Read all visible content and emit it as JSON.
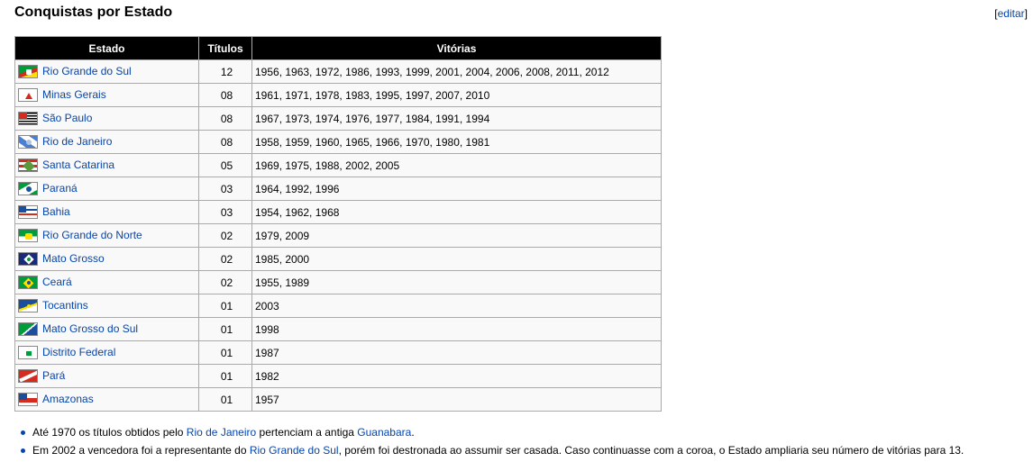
{
  "section": {
    "title": "Conquistas por Estado",
    "edit_open": "[",
    "edit_label": "editar",
    "edit_close": "]"
  },
  "table": {
    "headers": {
      "state": "Estado",
      "titles": "Títulos",
      "wins": "Vitórias"
    },
    "rows": [
      {
        "state": "Rio Grande do Sul",
        "titles": "12",
        "wins": "1956, 1963, 1972, 1986, 1993, 1999, 2001, 2004, 2006, 2008, 2011, 2012",
        "flag_icon": "rio-grande-do-sul-flag-icon"
      },
      {
        "state": "Minas Gerais",
        "titles": "08",
        "wins": "1961, 1971, 1978, 1983, 1995, 1997, 2007, 2010",
        "flag_icon": "minas-gerais-flag-icon"
      },
      {
        "state": "São Paulo",
        "titles": "08",
        "wins": "1967, 1973, 1974, 1976, 1977, 1984, 1991, 1994",
        "flag_icon": "sao-paulo-flag-icon"
      },
      {
        "state": "Rio de Janeiro",
        "titles": "08",
        "wins": "1958, 1959, 1960, 1965, 1966, 1970, 1980, 1981",
        "flag_icon": "rio-de-janeiro-flag-icon"
      },
      {
        "state": "Santa Catarina",
        "titles": "05",
        "wins": "1969, 1975, 1988, 2002, 2005",
        "flag_icon": "santa-catarina-flag-icon"
      },
      {
        "state": "Paraná",
        "titles": "03",
        "wins": "1964, 1992, 1996",
        "flag_icon": "parana-flag-icon"
      },
      {
        "state": "Bahia",
        "titles": "03",
        "wins": "1954, 1962, 1968",
        "flag_icon": "bahia-flag-icon"
      },
      {
        "state": "Rio Grande do Norte",
        "titles": "02",
        "wins": "1979, 2009",
        "flag_icon": "rio-grande-do-norte-flag-icon"
      },
      {
        "state": "Mato Grosso",
        "titles": "02",
        "wins": "1985, 2000",
        "flag_icon": "mato-grosso-flag-icon"
      },
      {
        "state": "Ceará",
        "titles": "02",
        "wins": "1955, 1989",
        "flag_icon": "ceara-flag-icon"
      },
      {
        "state": "Tocantins",
        "titles": "01",
        "wins": "2003",
        "flag_icon": "tocantins-flag-icon"
      },
      {
        "state": "Mato Grosso do Sul",
        "titles": "01",
        "wins": "1998",
        "flag_icon": "mato-grosso-do-sul-flag-icon"
      },
      {
        "state": "Distrito Federal",
        "titles": "01",
        "wins": "1987",
        "flag_icon": "distrito-federal-flag-icon"
      },
      {
        "state": "Pará",
        "titles": "01",
        "wins": "1982",
        "flag_icon": "para-flag-icon"
      },
      {
        "state": "Amazonas",
        "titles": "01",
        "wins": "1957",
        "flag_icon": "amazonas-flag-icon"
      }
    ]
  },
  "notes": [
    {
      "before": "Até 1970 os títulos obtidos pelo ",
      "link1": "Rio de Janeiro",
      "middle": " pertenciam a antiga ",
      "link2": "Guanabara",
      "after": "."
    },
    {
      "before": "Em 2002 a vencedora foi a representante do ",
      "link1": "Rio Grande do Sul",
      "middle": ", porém foi destronada ao assumir ser casada. Caso continuasse com a coroa, o Estado ampliaria seu número de vitórias para 13.",
      "link2": "",
      "after": ""
    }
  ],
  "colors": {
    "link": "#0645ad",
    "header_bg": "#000000",
    "cell_bg": "#f9f9f9",
    "border": "#aaaaaa"
  }
}
